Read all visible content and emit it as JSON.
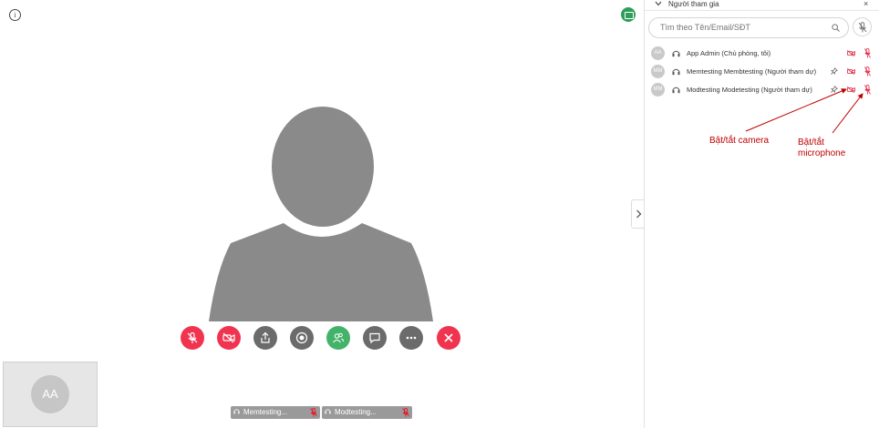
{
  "stage": {
    "info_icon": "info-icon",
    "info_glyph": "i",
    "layout_icon": "layout-icon",
    "avatar_icon": "person-silhouette-icon",
    "controls": [
      {
        "name": "mic-toggle-button",
        "icon": "mic-off-icon",
        "color": "#f0344f"
      },
      {
        "name": "camera-toggle-button",
        "icon": "camera-off-icon",
        "color": "#f0344f"
      },
      {
        "name": "share-screen-button",
        "icon": "share-icon",
        "color": "#6b6b6b"
      },
      {
        "name": "record-button",
        "icon": "record-icon",
        "color": "#6b6b6b"
      },
      {
        "name": "participants-button",
        "icon": "people-icon",
        "color": "#43b36a"
      },
      {
        "name": "chat-button",
        "icon": "chat-icon",
        "color": "#6b6b6b"
      },
      {
        "name": "more-button",
        "icon": "more-icon",
        "color": "#6b6b6b"
      },
      {
        "name": "leave-button",
        "icon": "close-icon",
        "color": "#f0344f"
      }
    ],
    "self_view": {
      "initials": "AA"
    },
    "thumbnails": [
      {
        "label": "Memtesting..."
      },
      {
        "label": "Modtesting..."
      }
    ]
  },
  "panel": {
    "title": "Người tham gia",
    "close_glyph": "×",
    "search": {
      "placeholder": "Tìm theo Tên/Email/SĐT",
      "value": ""
    },
    "participants": [
      {
        "initials": "AA",
        "name": "App Admin (Chủ phòng, tôi)",
        "pinned": false
      },
      {
        "initials": "MM",
        "name": "Memtesting Membtesting (Người tham dự)",
        "pinned": true
      },
      {
        "initials": "MM",
        "name": "Modtesting Modetesting (Người tham dự)",
        "pinned": true
      }
    ]
  },
  "annotations": {
    "camera": "Bật/tắt camera",
    "microphone_line1": "Bật/tắt",
    "microphone_line2": "microphone"
  },
  "colors": {
    "accent_red": "#f0344f",
    "accent_green": "#43b36a",
    "gray": "#6b6b6b",
    "annotation_red": "#c00000"
  }
}
